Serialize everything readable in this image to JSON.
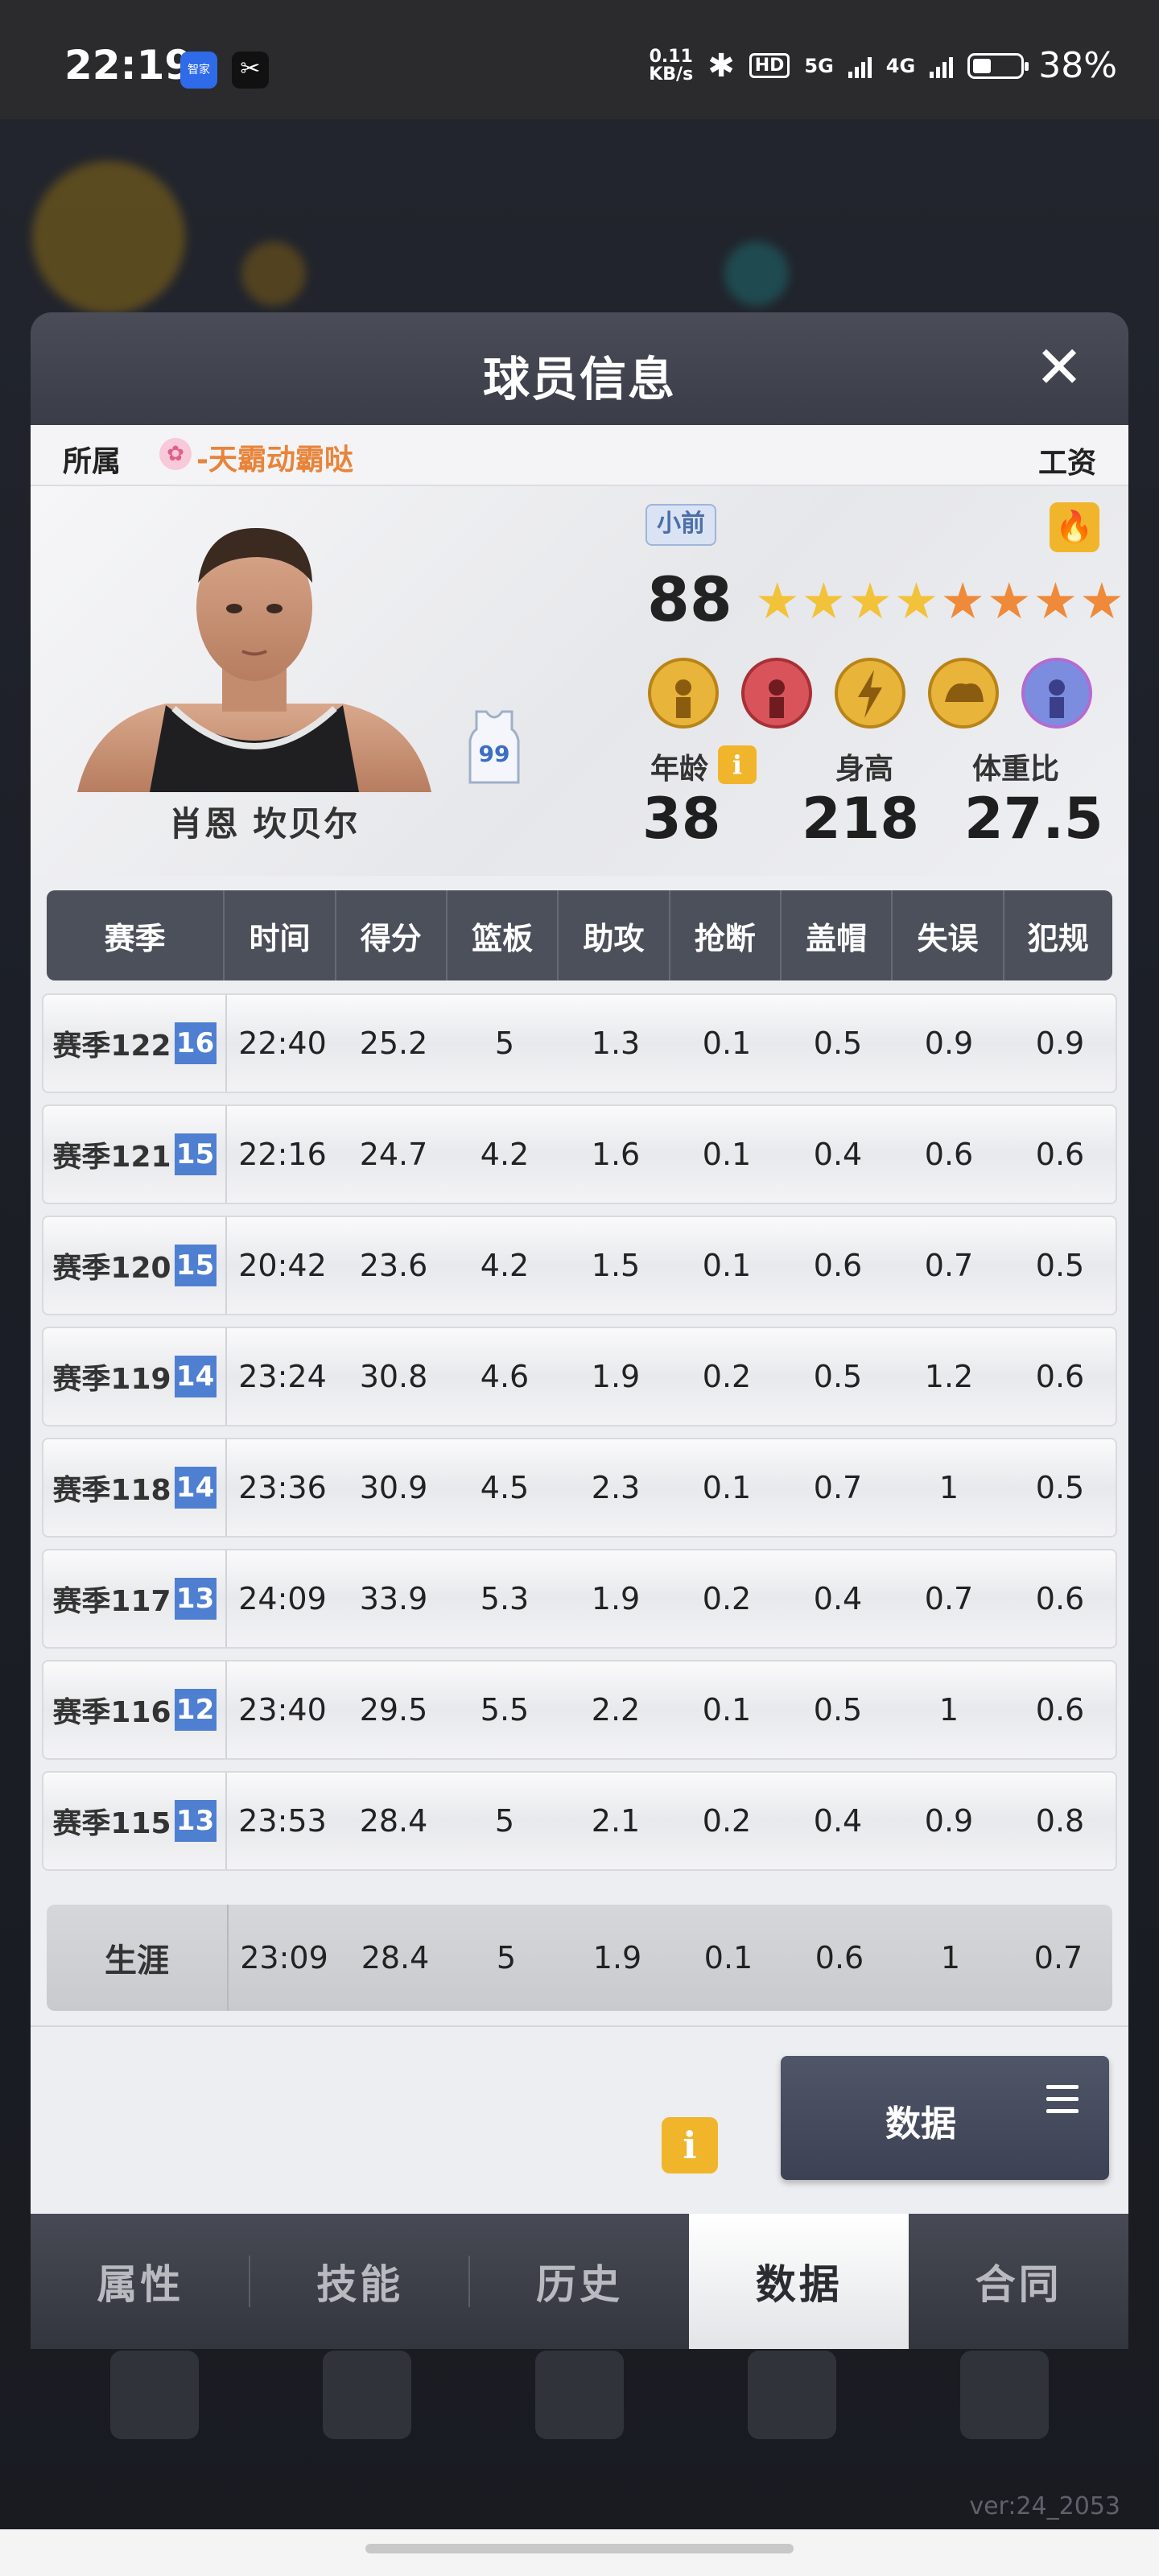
{
  "status_bar": {
    "time": "22:19",
    "app1_label": "智家",
    "app2_icon": "scissors-icon",
    "net_speed_value": "0.11",
    "net_speed_unit": "KB/s",
    "hd_label": "HD",
    "sig_5g": "5G",
    "sig_4g": "4G",
    "battery_pct": "38%"
  },
  "modal": {
    "title": "球员信息",
    "close_icon": "close-icon"
  },
  "owner": {
    "label": "所属",
    "team": "-天霸动霸哒",
    "salary_label": "工资"
  },
  "player": {
    "name": "肖恩 坎贝尔",
    "jersey_number": "99",
    "position": "小前",
    "rating": "88",
    "stars_gold": 4,
    "stars_orange": 4,
    "age_label": "年龄",
    "age": "38",
    "height_label": "身高",
    "height": "218",
    "weight_label": "体重比",
    "weight": "27.5",
    "info_icon": "i"
  },
  "table": {
    "headers": [
      "赛季",
      "时间",
      "得分",
      "篮板",
      "助攻",
      "抢断",
      "盖帽",
      "失误",
      "犯规"
    ],
    "rows": [
      {
        "season": "赛季122",
        "badge": "16",
        "time": "22:40",
        "pts": "25.2",
        "reb": "5",
        "ast": "1.3",
        "stl": "0.1",
        "blk": "0.5",
        "tov": "0.9",
        "pf": "0.9"
      },
      {
        "season": "赛季121",
        "badge": "15",
        "time": "22:16",
        "pts": "24.7",
        "reb": "4.2",
        "ast": "1.6",
        "stl": "0.1",
        "blk": "0.4",
        "tov": "0.6",
        "pf": "0.6"
      },
      {
        "season": "赛季120",
        "badge": "15",
        "time": "20:42",
        "pts": "23.6",
        "reb": "4.2",
        "ast": "1.5",
        "stl": "0.1",
        "blk": "0.6",
        "tov": "0.7",
        "pf": "0.5"
      },
      {
        "season": "赛季119",
        "badge": "14",
        "time": "23:24",
        "pts": "30.8",
        "reb": "4.6",
        "ast": "1.9",
        "stl": "0.2",
        "blk": "0.5",
        "tov": "1.2",
        "pf": "0.6"
      },
      {
        "season": "赛季118",
        "badge": "14",
        "time": "23:36",
        "pts": "30.9",
        "reb": "4.5",
        "ast": "2.3",
        "stl": "0.1",
        "blk": "0.7",
        "tov": "1",
        "pf": "0.5"
      },
      {
        "season": "赛季117",
        "badge": "13",
        "time": "24:09",
        "pts": "33.9",
        "reb": "5.3",
        "ast": "1.9",
        "stl": "0.2",
        "blk": "0.4",
        "tov": "0.7",
        "pf": "0.6"
      },
      {
        "season": "赛季116",
        "badge": "12",
        "time": "23:40",
        "pts": "29.5",
        "reb": "5.5",
        "ast": "2.2",
        "stl": "0.1",
        "blk": "0.5",
        "tov": "1",
        "pf": "0.6"
      },
      {
        "season": "赛季115",
        "badge": "13",
        "time": "23:53",
        "pts": "28.4",
        "reb": "5",
        "ast": "2.1",
        "stl": "0.2",
        "blk": "0.4",
        "tov": "0.9",
        "pf": "0.8"
      }
    ],
    "career": {
      "label": "生涯",
      "time": "23:09",
      "pts": "28.4",
      "reb": "5",
      "ast": "1.9",
      "stl": "0.1",
      "blk": "0.6",
      "tov": "1",
      "pf": "0.7"
    }
  },
  "footer": {
    "info_icon": "i",
    "data_button": "数据"
  },
  "tabs": [
    "属性",
    "技能",
    "历史",
    "数据",
    "合同"
  ],
  "active_tab": "数据",
  "version": "ver:24_2053",
  "colors": {
    "accent_yellow": "#f1b52b",
    "season_badge_blue": "#4f7fd1",
    "team_orange": "#e8843a",
    "header_dark": "#4c505b"
  }
}
